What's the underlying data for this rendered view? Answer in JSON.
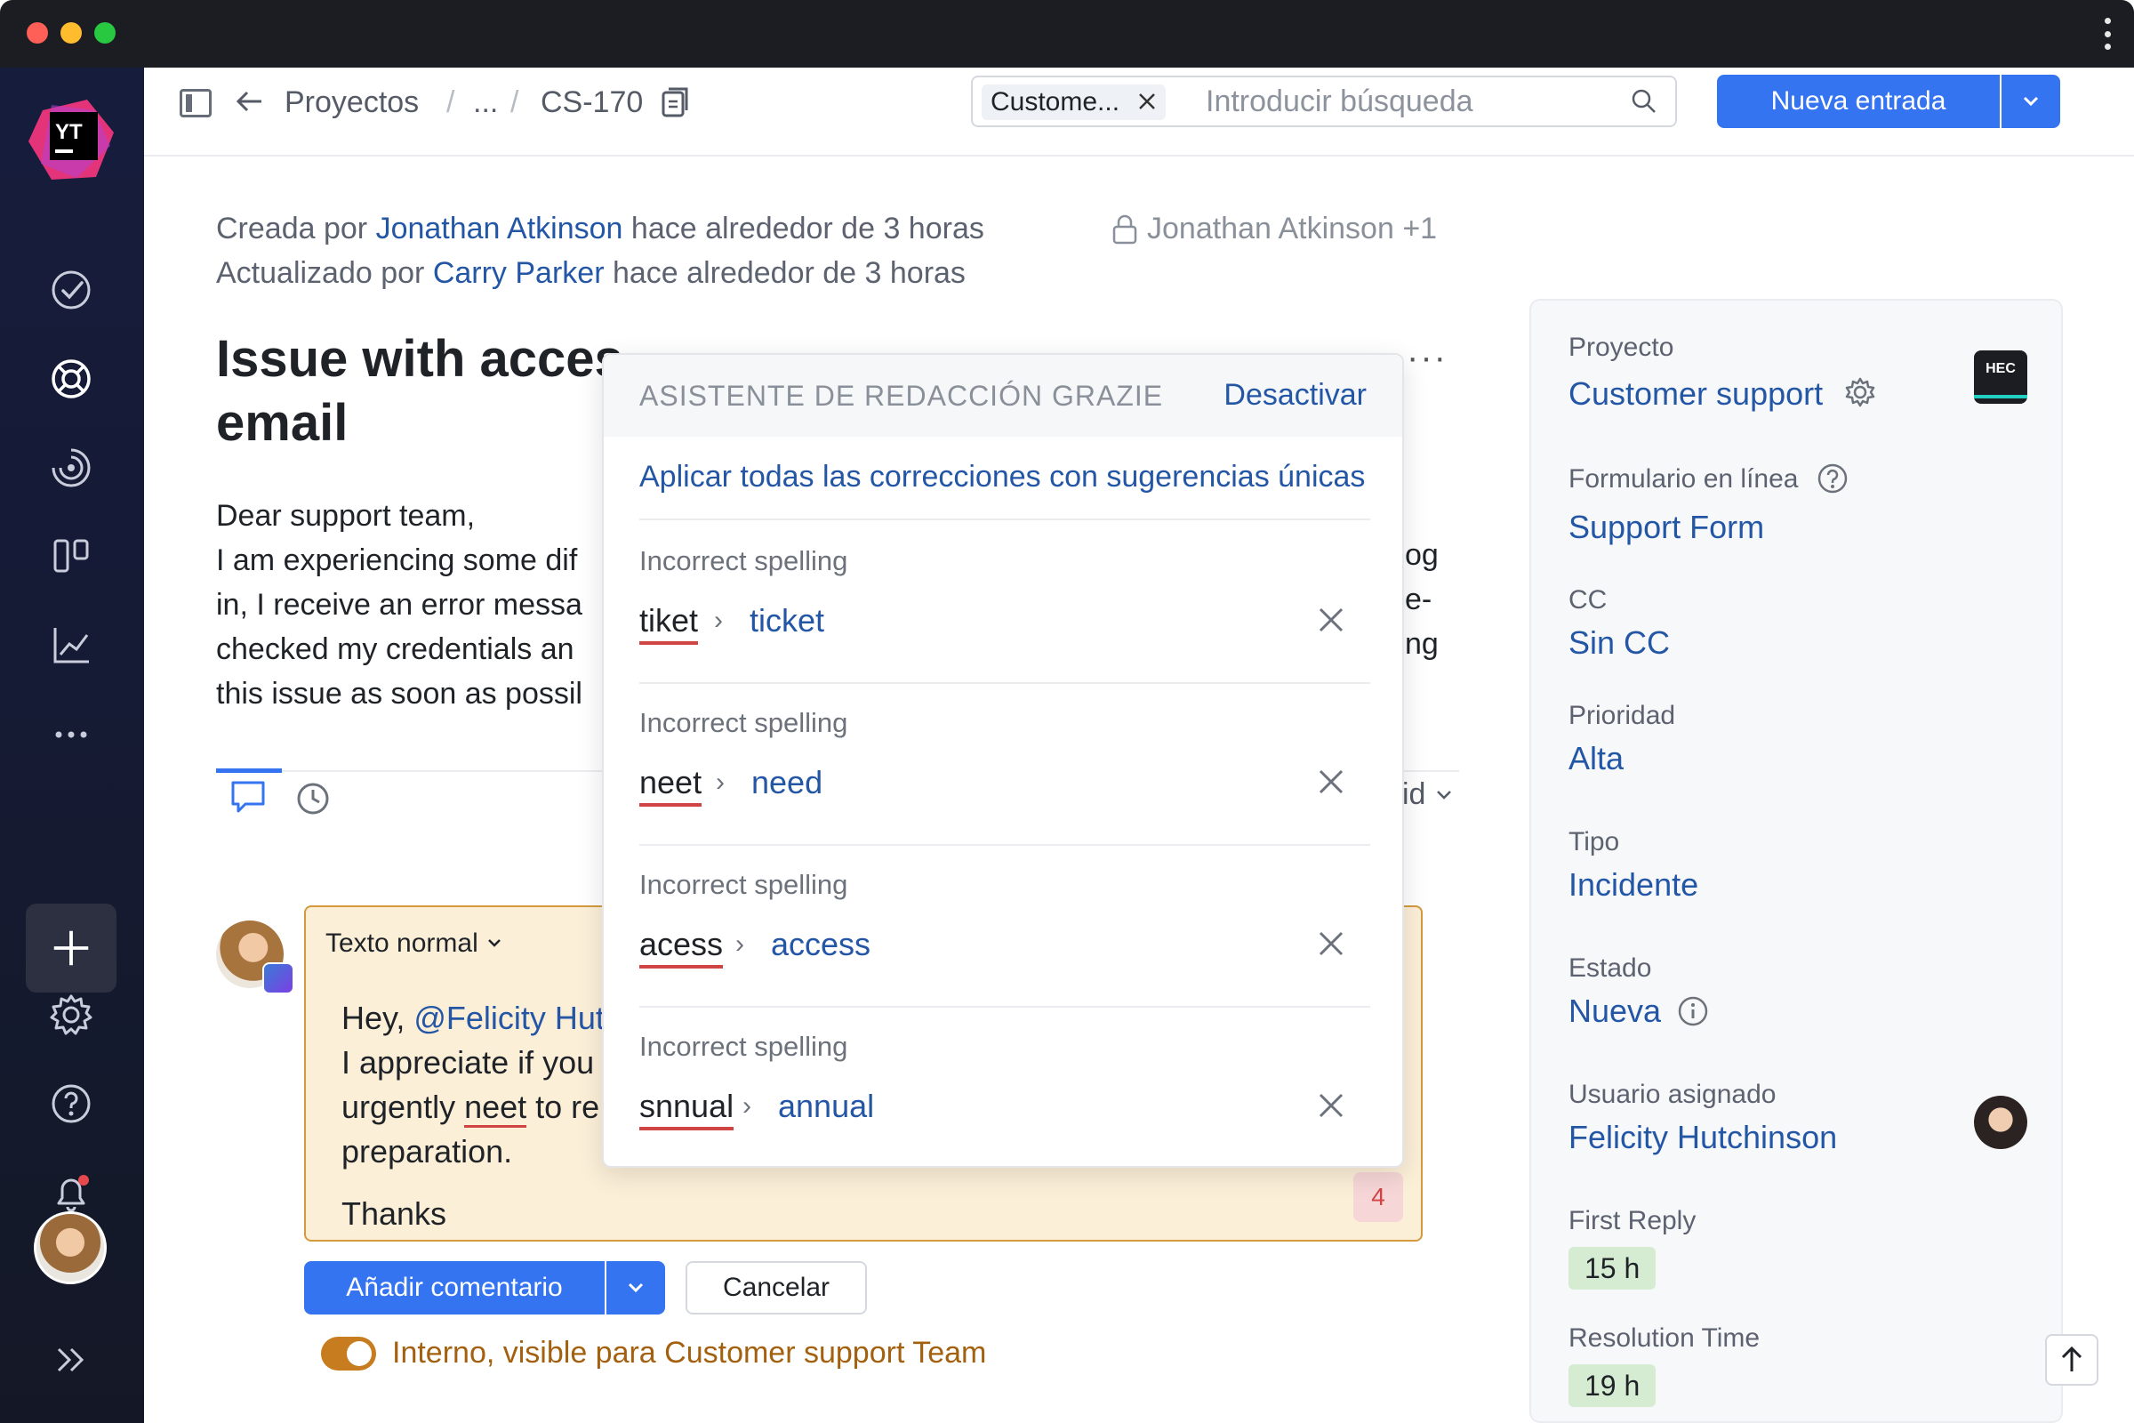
{
  "window": {
    "traffic_colors": [
      "#fe5f57",
      "#febc2e",
      "#28c840"
    ]
  },
  "sidebar": {
    "logo_text": "YT",
    "items": [
      {
        "name": "tasks-icon"
      },
      {
        "name": "helpdesk-icon"
      },
      {
        "name": "activity-icon"
      },
      {
        "name": "boards-icon"
      },
      {
        "name": "reports-icon"
      },
      {
        "name": "more-icon"
      }
    ],
    "bottom": [
      "add-icon",
      "settings-icon",
      "help-icon",
      "notifications-icon",
      "avatar",
      "expand-icon"
    ]
  },
  "topbar": {
    "projects": "Proyectos",
    "sep": "/",
    "ellipsis": "...",
    "issue_id": "CS-170",
    "search_chip": "Custome...",
    "search_placeholder": "Introducir búsqueda",
    "new_entry": "Nueva entrada"
  },
  "meta": {
    "created_prefix": "Creada por",
    "created_by": "Jonathan Atkinson",
    "created_suffix": "hace alrededor de 3 horas",
    "updated_prefix": "Actualizado por",
    "updated_by": "Carry Parker",
    "updated_suffix": "hace alrededor de 3 horas",
    "visibility": "Jonathan Atkinson +1"
  },
  "issue": {
    "title_visible": "Issue with acces",
    "title_tail": "email",
    "body_lines": [
      "Dear support team,",
      "I am experiencing some dif",
      "in, I receive an error messa",
      "checked my credentials an",
      "this issue as soon as possil"
    ],
    "body_right_fragments": [
      "og",
      "e-",
      "ng"
    ],
    "activity_right": "id"
  },
  "comment": {
    "text_style": "Texto normal",
    "line1_prefix": "Hey, ",
    "mention": "@Felicity Hut",
    "line2": "I appreciate if you",
    "line3_prefix": "urgently ",
    "line3_error": "neet",
    "line3_suffix": " to re",
    "line4": "preparation.",
    "line5": "Thanks",
    "issue_count": "4",
    "add_button": "Añadir comentario",
    "cancel_button": "Cancelar",
    "internal_label": "Interno, visible para Customer support Team"
  },
  "grazie": {
    "title": "ASISTENTE DE REDACCIÓN GRAZIE",
    "deactivate": "Desactivar",
    "apply_all": "Aplicar todas las correcciones con sugerencias únicas",
    "suggestions": [
      {
        "label": "Incorrect spelling",
        "wrong": "tiket",
        "right": "ticket"
      },
      {
        "label": "Incorrect spelling",
        "wrong": "neet",
        "right": "need"
      },
      {
        "label": "Incorrect spelling",
        "wrong": "acess",
        "right": "access"
      },
      {
        "label": "Incorrect spelling",
        "wrong": "snnual",
        "right": "annual"
      }
    ]
  },
  "details": {
    "project_label": "Proyecto",
    "project_value": "Customer support",
    "project_logo": "HEC",
    "form_label": "Formulario en línea",
    "form_value": "Support Form",
    "cc_label": "CC",
    "cc_value": "Sin CC",
    "priority_label": "Prioridad",
    "priority_value": "Alta",
    "type_label": "Tipo",
    "type_value": "Incidente",
    "state_label": "Estado",
    "state_value": "Nueva",
    "assignee_label": "Usuario asignado",
    "assignee_value": "Felicity Hutchinson",
    "first_reply_label": "First Reply",
    "first_reply_value": "15 h",
    "resolution_label": "Resolution Time",
    "resolution_value": "19 h"
  },
  "colors": {
    "accent": "#3574f0",
    "link": "#2456a6",
    "error": "#d04444",
    "internal": "#c77d1f"
  }
}
